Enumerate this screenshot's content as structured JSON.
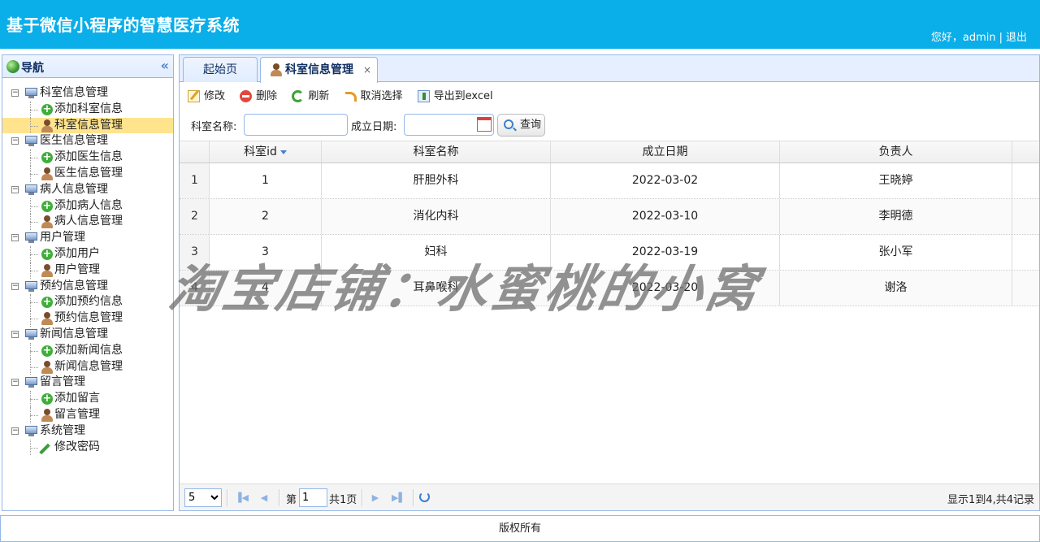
{
  "header": {
    "title": "基于微信小程序的智慧医疗系统",
    "greeting": "您好，",
    "username": "admin",
    "separator": "|",
    "logout": "退出"
  },
  "nav": {
    "title": "导航",
    "collapse": "«",
    "groups": [
      {
        "label": "科室信息管理",
        "items": [
          {
            "label": "添加科室信息",
            "icon": "plus-icon"
          },
          {
            "label": "科室信息管理",
            "icon": "person-icon",
            "selected": true
          }
        ]
      },
      {
        "label": "医生信息管理",
        "items": [
          {
            "label": "添加医生信息",
            "icon": "plus-icon"
          },
          {
            "label": "医生信息管理",
            "icon": "person-icon"
          }
        ]
      },
      {
        "label": "病人信息管理",
        "items": [
          {
            "label": "添加病人信息",
            "icon": "plus-icon"
          },
          {
            "label": "病人信息管理",
            "icon": "person-icon"
          }
        ]
      },
      {
        "label": "用户管理",
        "items": [
          {
            "label": "添加用户",
            "icon": "plus-icon"
          },
          {
            "label": "用户管理",
            "icon": "person-icon"
          }
        ]
      },
      {
        "label": "预约信息管理",
        "items": [
          {
            "label": "添加预约信息",
            "icon": "plus-icon"
          },
          {
            "label": "预约信息管理",
            "icon": "person-icon"
          }
        ]
      },
      {
        "label": "新闻信息管理",
        "items": [
          {
            "label": "添加新闻信息",
            "icon": "plus-icon"
          },
          {
            "label": "新闻信息管理",
            "icon": "person-icon"
          }
        ]
      },
      {
        "label": "留言管理",
        "items": [
          {
            "label": "添加留言",
            "icon": "plus-icon"
          },
          {
            "label": "留言管理",
            "icon": "person-icon"
          }
        ]
      },
      {
        "label": "系统管理",
        "items": [
          {
            "label": "修改密码",
            "icon": "pencil-icon"
          }
        ]
      }
    ]
  },
  "tabs": [
    {
      "label": "起始页"
    },
    {
      "label": "科室信息管理",
      "close": "×"
    }
  ],
  "toolbar": {
    "edit": "修改",
    "delete": "删除",
    "refresh": "刷新",
    "unselect": "取消选择",
    "export": "导出到excel"
  },
  "search": {
    "name_label": "科室名称:",
    "name_value": "",
    "date_label": "成立日期:",
    "date_value": "",
    "query": "查询"
  },
  "grid": {
    "columns": [
      "科室id",
      "科室名称",
      "成立日期",
      "负责人"
    ],
    "rows": [
      {
        "rn": "1",
        "id": "1",
        "name": "肝胆外科",
        "date": "2022-03-02",
        "lead": "王晓婷"
      },
      {
        "rn": "2",
        "id": "2",
        "name": "消化内科",
        "date": "2022-03-10",
        "lead": "李明德"
      },
      {
        "rn": "3",
        "id": "3",
        "name": "妇科",
        "date": "2022-03-19",
        "lead": "张小军"
      },
      {
        "rn": "4",
        "id": "4",
        "name": "耳鼻喉科",
        "date": "2022-03-20",
        "lead": "谢洛"
      }
    ]
  },
  "pager": {
    "page_size": "5",
    "page_prefix": "第",
    "page_value": "1",
    "total_pages": "共1页",
    "info": "显示1到4,共4记录"
  },
  "footer": {
    "text": "版权所有"
  },
  "watermark": "淘宝店铺：水蜜桃的小窝",
  "colors": {
    "header_bg": "#0aaee8",
    "border": "#95b8e7",
    "selected": "#ffe48d"
  }
}
